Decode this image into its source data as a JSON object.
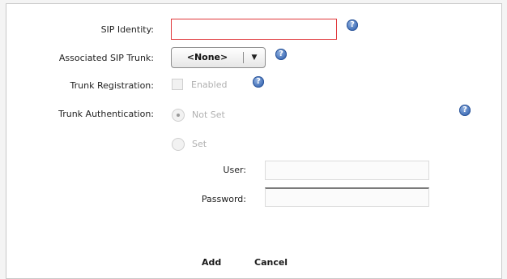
{
  "form": {
    "sip_identity": {
      "label": "SIP Identity:",
      "value": ""
    },
    "associated_trunk": {
      "label": "Associated SIP Trunk:",
      "selected": "<None>"
    },
    "trunk_registration": {
      "label": "Trunk Registration:",
      "checkbox_label": "Enabled",
      "checked": false
    },
    "trunk_authentication": {
      "label": "Trunk Authentication:",
      "options": [
        {
          "label": "Not Set",
          "selected": true
        },
        {
          "label": "Set",
          "selected": false
        }
      ],
      "user_label": "User:",
      "password_label": "Password:"
    },
    "help_glyph": "?"
  },
  "actions": {
    "add": "Add",
    "cancel": "Cancel"
  },
  "colors": {
    "error_border": "#e0373b",
    "help_icon": "#3f6db6",
    "disabled_text": "#b0b0b0"
  }
}
